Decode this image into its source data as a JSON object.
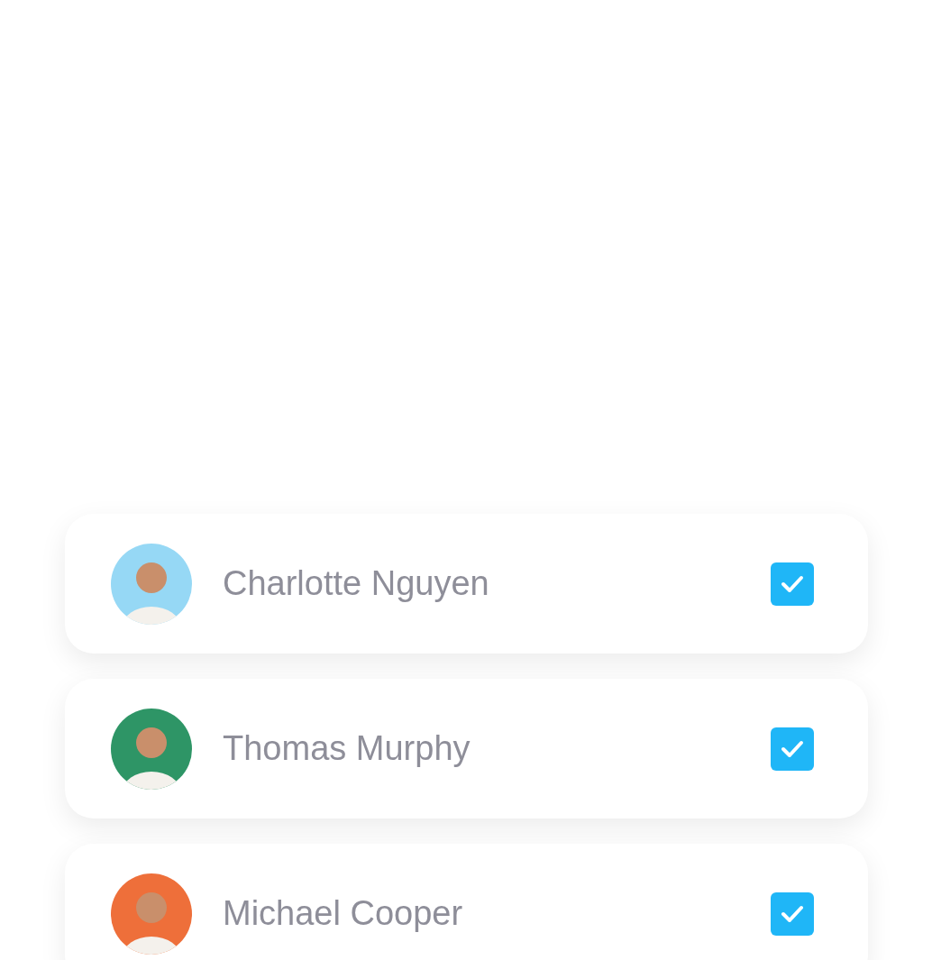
{
  "contacts": [
    {
      "name": "Charlotte Nguyen",
      "color": "#96d8f5",
      "checked": true
    },
    {
      "name": "Thomas Murphy",
      "color": "#2e9566",
      "checked": true
    },
    {
      "name": "Michael Cooper",
      "color": "#ee6f3a",
      "checked": true
    }
  ]
}
